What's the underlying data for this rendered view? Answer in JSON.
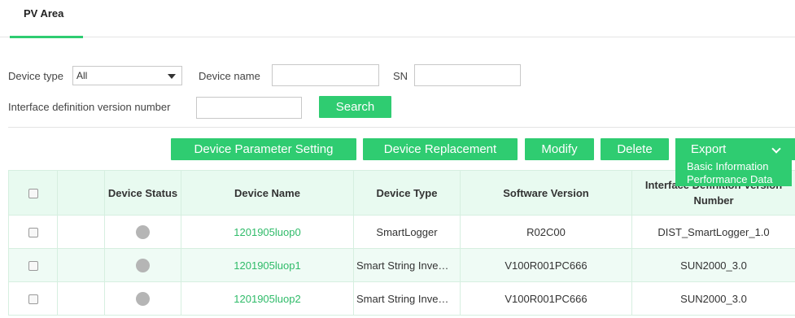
{
  "tabs": [
    {
      "label": "PV Area",
      "active": true
    }
  ],
  "filters": {
    "device_type_label": "Device type",
    "device_type_value": "All",
    "device_name_label": "Device name",
    "device_name_value": "",
    "sn_label": "SN",
    "sn_value": "",
    "interface_version_label": "Interface definition version number",
    "interface_version_value": "",
    "search_button": "Search"
  },
  "actions": {
    "device_parameter_setting": "Device Parameter Setting",
    "device_replacement": "Device Replacement",
    "modify": "Modify",
    "delete": "Delete",
    "export": "Export",
    "export_menu": [
      "Basic Information",
      "Performance Data"
    ]
  },
  "table": {
    "headers": {
      "device_status": "Device Status",
      "device_name": "Device Name",
      "device_type": "Device Type",
      "software_version": "Software Version",
      "interface_version": "Interface Definition Version Number"
    },
    "rows": [
      {
        "device_name": "1201905luop0",
        "device_type": "SmartLogger",
        "software_version": "R02C00",
        "interface_version": "DIST_SmartLogger_1.0",
        "status": "offline-grey"
      },
      {
        "device_name": "1201905luop1",
        "device_type": "Smart String Inve…",
        "software_version": "V100R001PC666",
        "interface_version": "SUN2000_3.0",
        "status": "offline-grey"
      },
      {
        "device_name": "1201905luop2",
        "device_type": "Smart String Inve…",
        "software_version": "V100R001PC666",
        "interface_version": "SUN2000_3.0",
        "status": "offline-grey"
      }
    ]
  },
  "colors": {
    "accent": "#2fcc71",
    "link": "#2fbb69",
    "header_bg": "#e8faf0",
    "status_grey": "#b5b5b5"
  }
}
